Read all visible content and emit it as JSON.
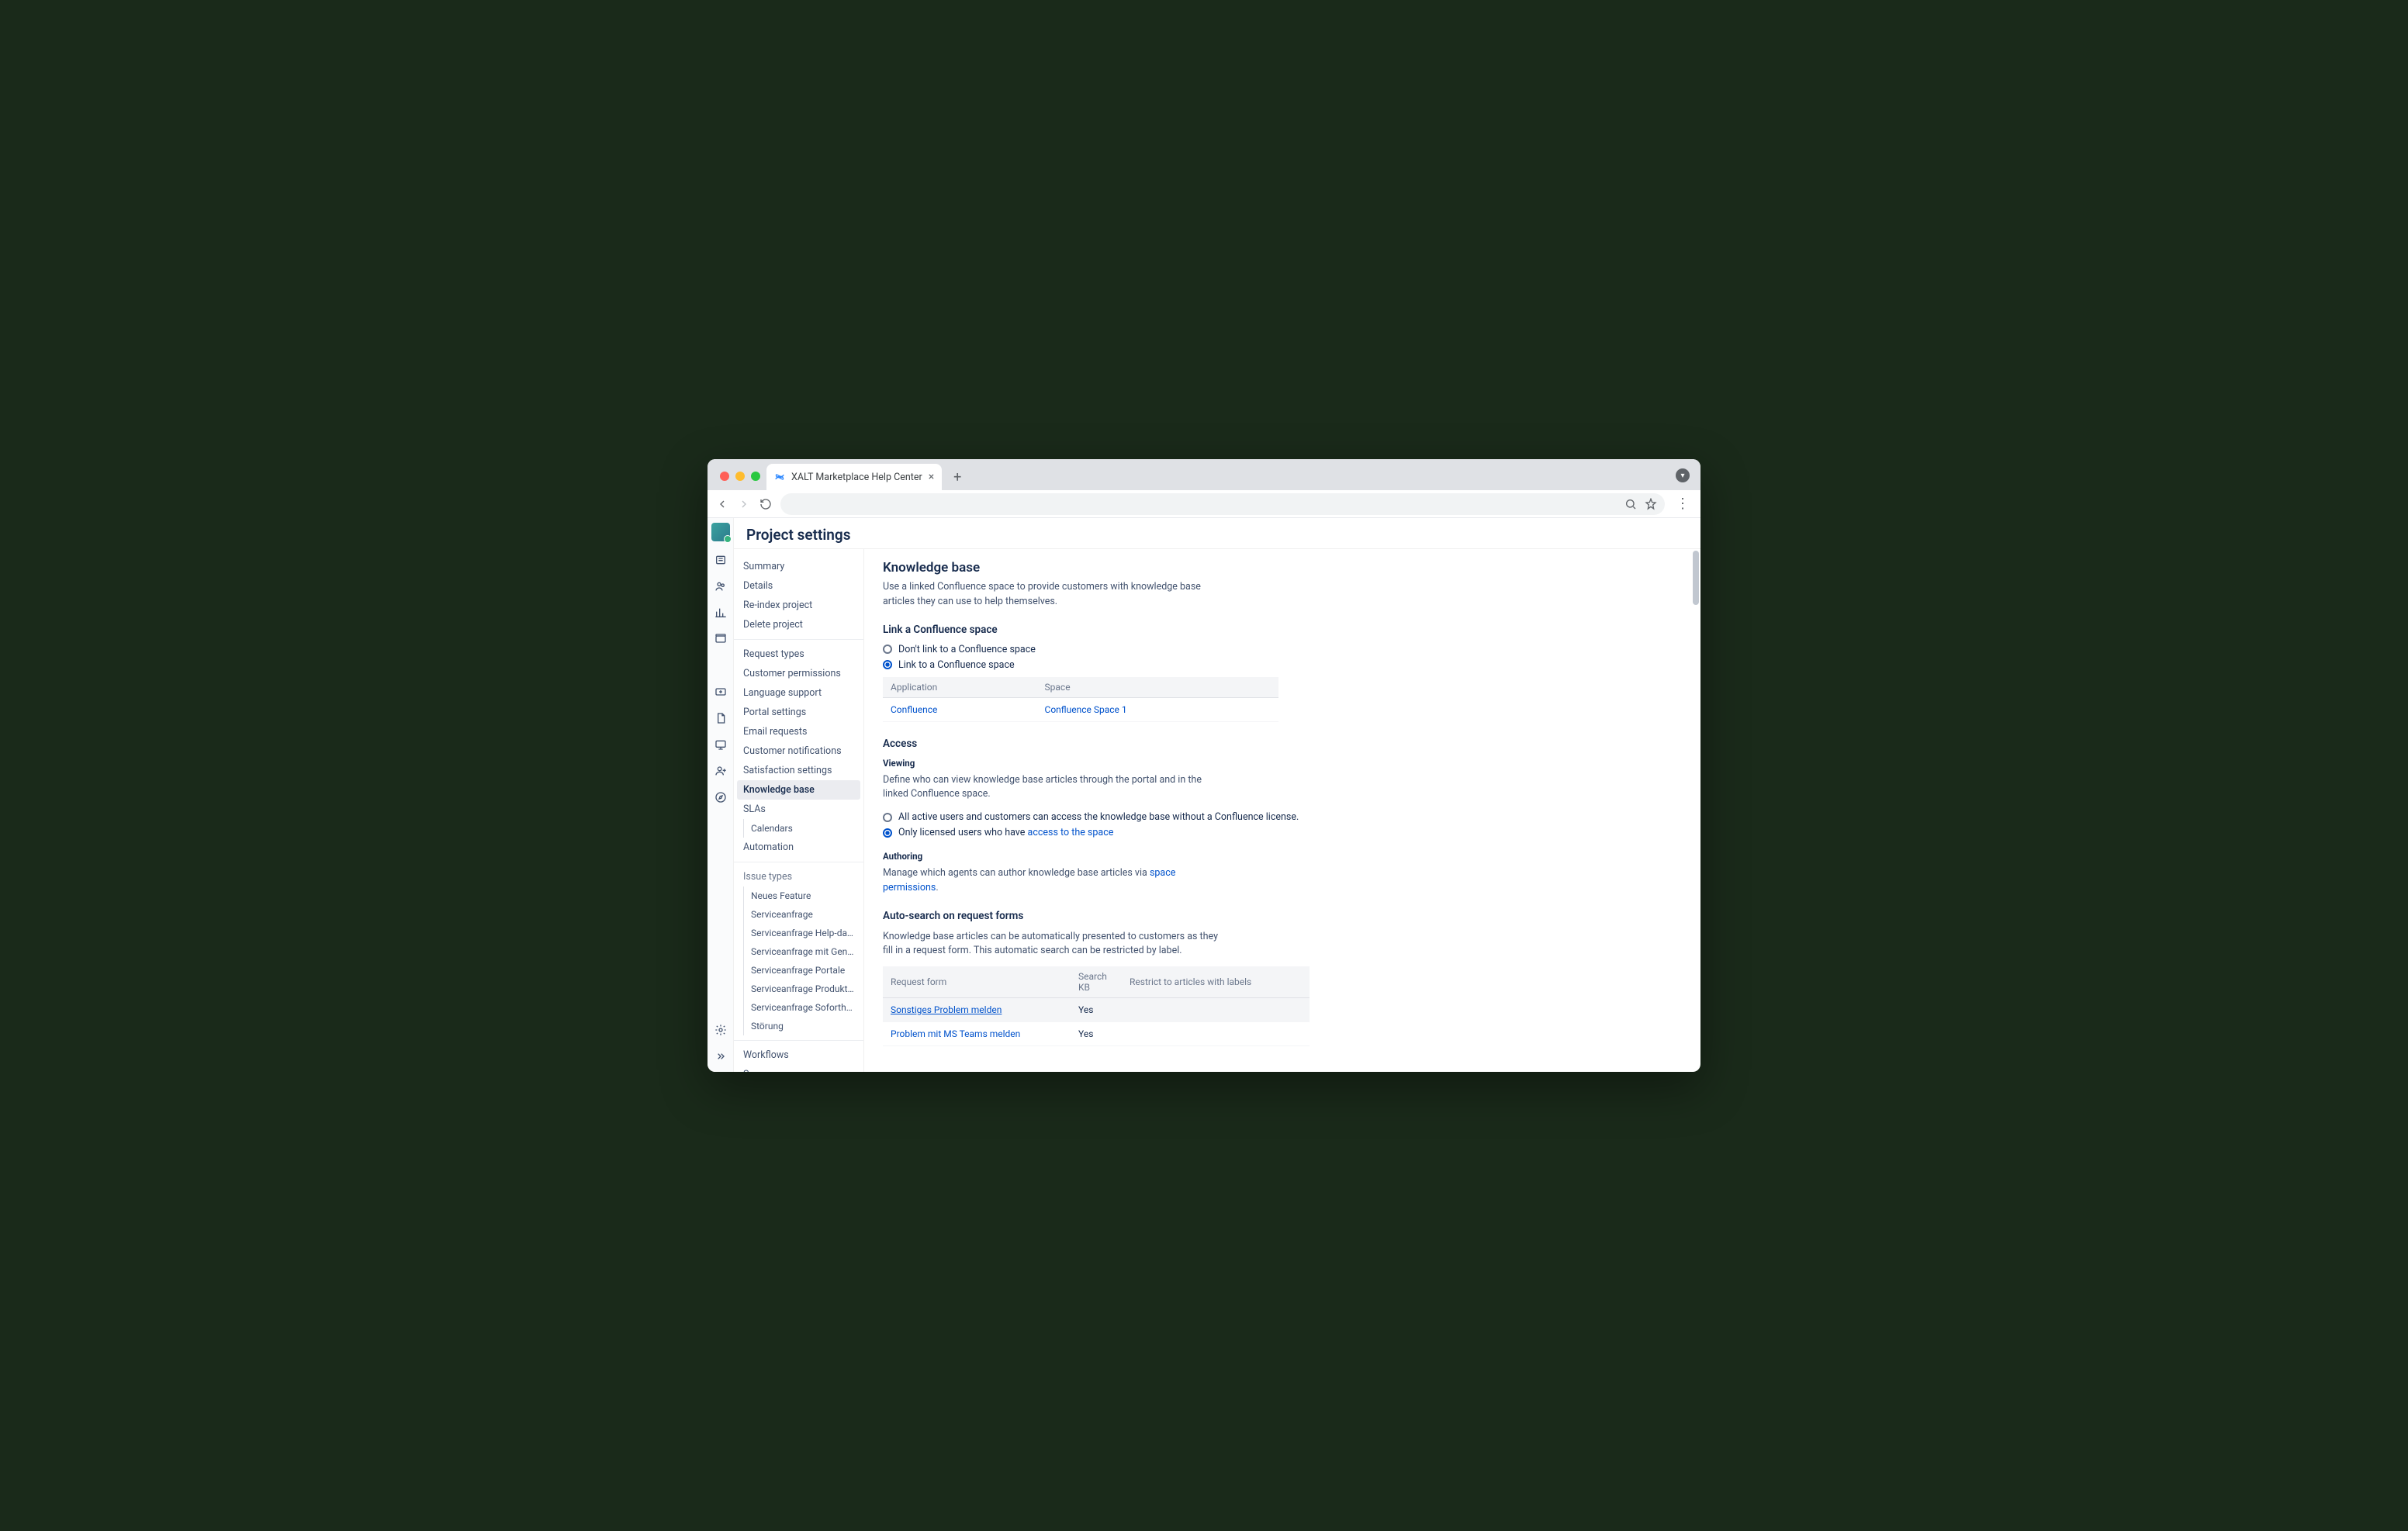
{
  "browser": {
    "tab_title": "XALT Marketplace Help Center"
  },
  "page_title": "Project settings",
  "sidebar": {
    "g1": [
      "Summary",
      "Details",
      "Re-index project",
      "Delete project"
    ],
    "g2": [
      "Request types",
      "Customer permissions",
      "Language support",
      "Portal settings",
      "Email requests",
      "Customer notifications",
      "Satisfaction settings",
      "Knowledge base",
      "SLAs"
    ],
    "g2_sub": "Calendars",
    "g2_tail": "Automation",
    "issue_types_label": "Issue types",
    "issue_types": [
      "Neues Feature",
      "Serviceanfrage",
      "Serviceanfrage Help-davinte...",
      "Serviceanfrage mit Genehmi...",
      "Serviceanfrage Portale",
      "Serviceanfrage Produkte & ...",
      "Serviceanfrage Soforthilfe",
      "Störung"
    ],
    "g4": [
      "Workflows",
      "Screens"
    ]
  },
  "kb": {
    "title": "Knowledge base",
    "desc": "Use a linked Confluence space to provide customers with knowledge base articles they can use to help themselves.",
    "link_h": "Link a Confluence space",
    "link_opt1": "Don't link to a Confluence space",
    "link_opt2": "Link to a Confluence space",
    "table_h_app": "Application",
    "table_h_space": "Space",
    "table_app": "Confluence",
    "table_space": "Confluence  Space  1",
    "access_h": "Access",
    "viewing_h": "Viewing",
    "viewing_desc": "Define who can view knowledge base articles through the portal and in the linked Confluence space.",
    "view_opt1": "All active users and customers can access the knowledge base without a Confluence license.",
    "view_opt2_a": "Only licensed users who have ",
    "view_opt2_link": "access to the space",
    "authoring_h": "Authoring",
    "authoring_text_a": "Manage which agents can author knowledge base articles via ",
    "authoring_link": "space permissions",
    "auto_h": "Auto-search on request forms",
    "auto_desc": "Knowledge base articles can be automatically presented to customers as they fill in a request form. This automatic search can be restricted by label.",
    "req_h1": "Request form",
    "req_h2": "Search KB",
    "req_h3": "Restrict to articles with labels",
    "rows": [
      {
        "name": "Sonstiges Problem melden",
        "kb": "Yes",
        "restrict": "",
        "hl": true,
        "u": true
      },
      {
        "name": "Problem mit MS Teams melden",
        "kb": "Yes",
        "restrict": "",
        "hl": false,
        "u": false
      }
    ]
  }
}
